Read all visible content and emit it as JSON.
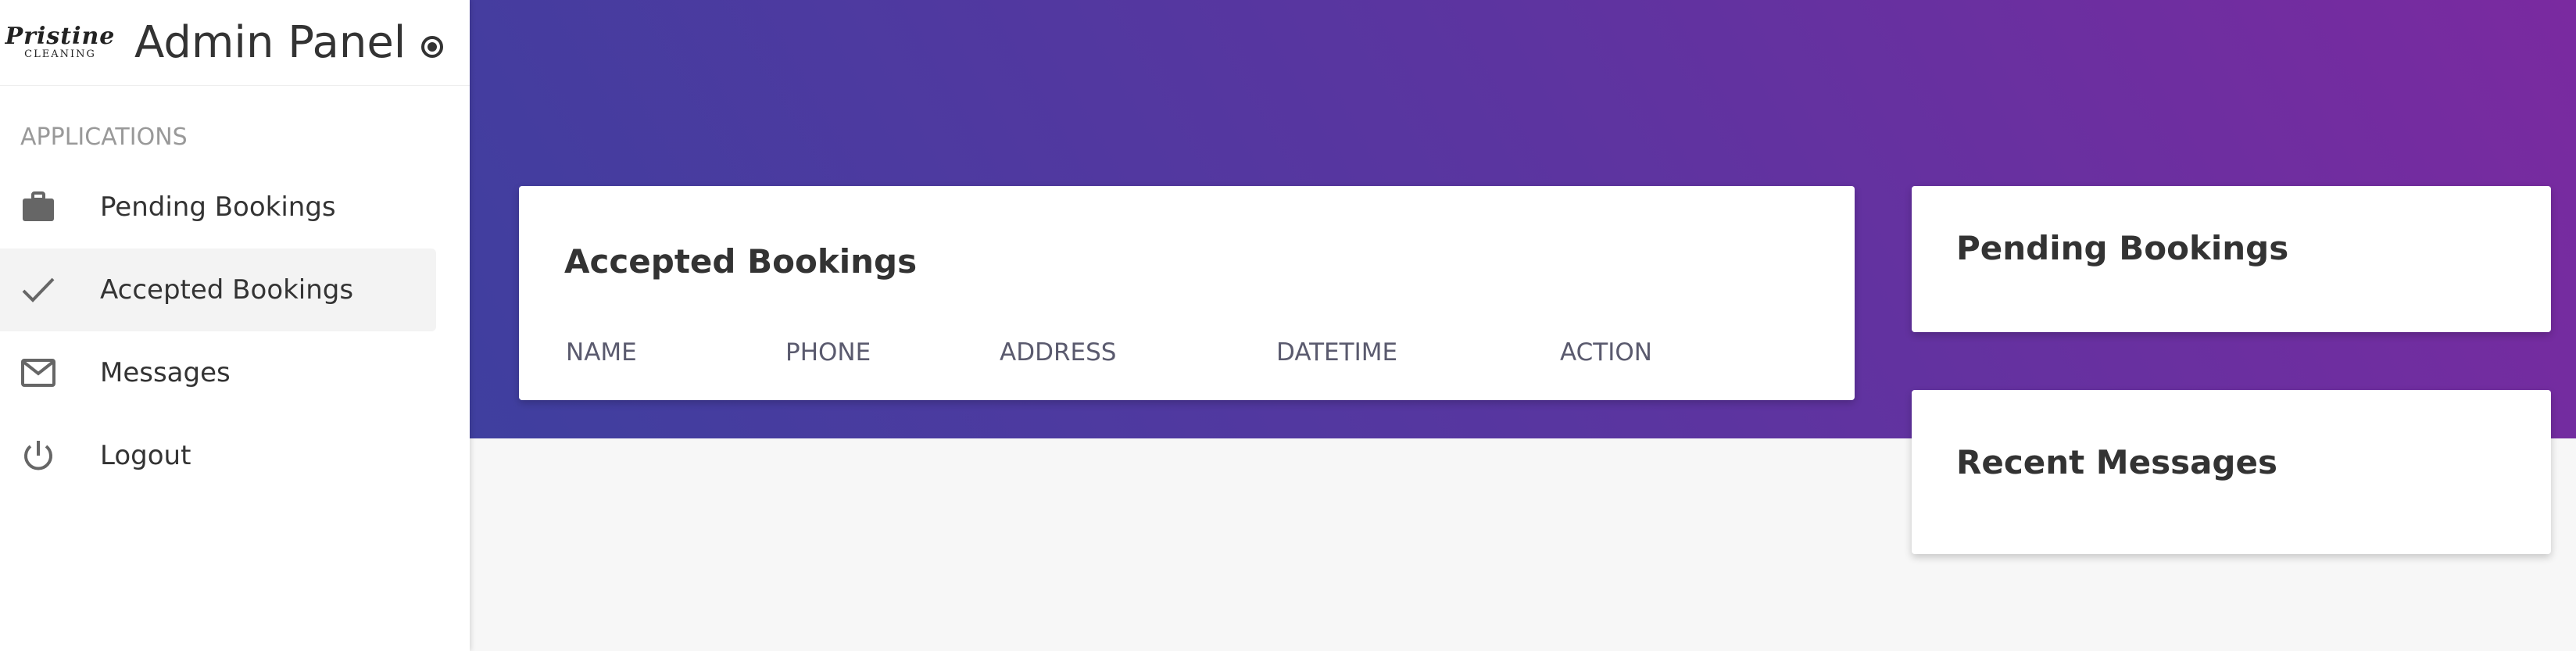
{
  "brand": {
    "logo_line1": "Pristine",
    "logo_line2": "CLEANING",
    "title": "Admin Panel"
  },
  "sidebar": {
    "section_label": "APPLICATIONS",
    "items": [
      {
        "label": "Pending Bookings",
        "icon": "briefcase-icon",
        "active": false
      },
      {
        "label": "Accepted Bookings",
        "icon": "check-icon",
        "active": true
      },
      {
        "label": "Messages",
        "icon": "mail-icon",
        "active": false
      },
      {
        "label": "Logout",
        "icon": "power-icon",
        "active": false
      }
    ]
  },
  "main": {
    "accepted_card": {
      "title": "Accepted Bookings",
      "columns": [
        "NAME",
        "PHONE",
        "ADDRESS",
        "DATETIME",
        "ACTION"
      ]
    },
    "pending_card": {
      "title": "Pending Bookings"
    },
    "messages_card": {
      "title": "Recent Messages"
    }
  },
  "colors": {
    "gradient_start": "#3f3f9f",
    "gradient_end": "#7a2aa0",
    "active_item_bg": "#f3f3f3"
  }
}
